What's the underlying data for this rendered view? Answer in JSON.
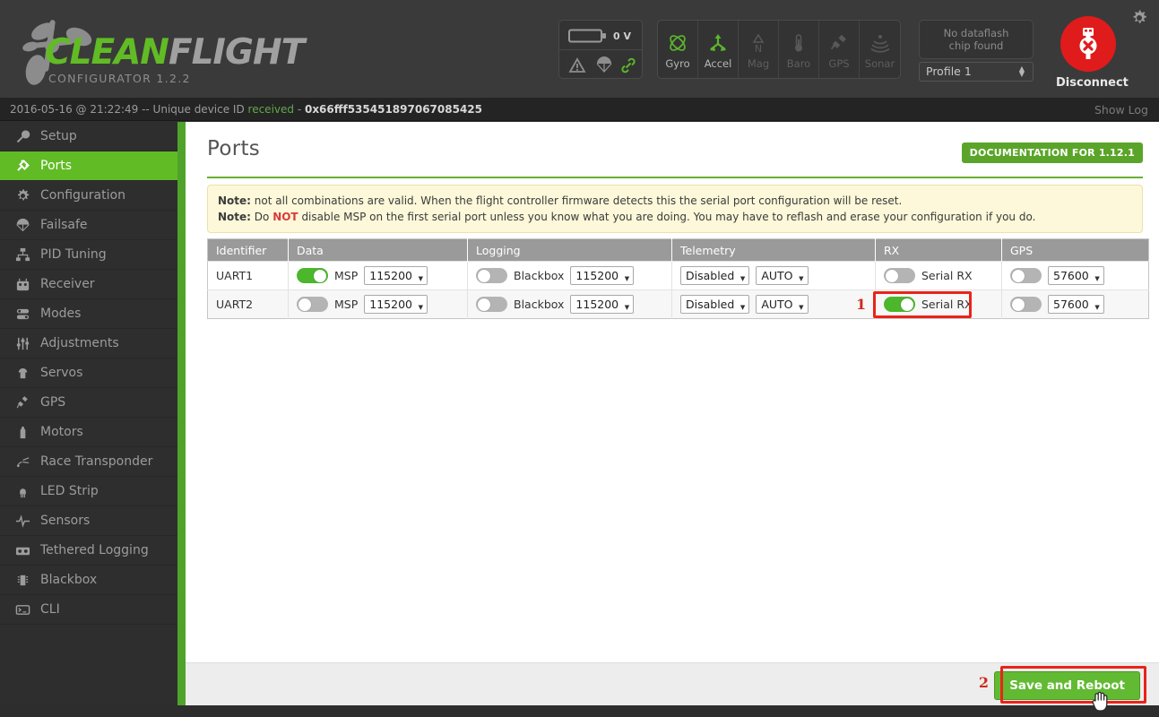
{
  "app": {
    "brand_clean": "CLEAN",
    "brand_flight": "FLIGHT",
    "subtitle": "CONFIGURATOR  1.2.2",
    "accent_green": "#61bb25",
    "danger_red": "#e8241a"
  },
  "header": {
    "battery_voltage": "0 V",
    "status_icons": [
      {
        "name": "warning-icon",
        "active": false
      },
      {
        "name": "parachute-icon",
        "active": false
      },
      {
        "name": "link-icon",
        "active": true
      }
    ],
    "sensors": [
      {
        "label": "Gyro",
        "icon": "gyro-icon",
        "active": true
      },
      {
        "label": "Accel",
        "icon": "accel-icon",
        "active": true
      },
      {
        "label": "Mag",
        "icon": "mag-icon",
        "active": false
      },
      {
        "label": "Baro",
        "icon": "baro-icon",
        "active": false
      },
      {
        "label": "GPS",
        "icon": "gps-icon",
        "active": false
      },
      {
        "label": "Sonar",
        "icon": "sonar-icon",
        "active": false
      }
    ],
    "dataflash_line1": "No dataflash",
    "dataflash_line2": "chip found",
    "profile_value": "Profile 1",
    "disconnect_label": "Disconnect",
    "settings_icon": "gear-icon"
  },
  "logbar": {
    "timestamp_text": "2016-05-16 @ 21:22:49 -- Unique device ID ",
    "status_word": "received",
    "separator": " - ",
    "device_id": "0x66fff535451897067085425",
    "show_log": "Show Log"
  },
  "sidebar": {
    "items": [
      {
        "label": "Setup",
        "icon": "wrench-icon",
        "active": false
      },
      {
        "label": "Ports",
        "icon": "plug-icon",
        "active": true
      },
      {
        "label": "Configuration",
        "icon": "gear-icon",
        "active": false
      },
      {
        "label": "Failsafe",
        "icon": "parachute-icon",
        "active": false
      },
      {
        "label": "PID Tuning",
        "icon": "sitemap-icon",
        "active": false
      },
      {
        "label": "Receiver",
        "icon": "transmitter-icon",
        "active": false
      },
      {
        "label": "Modes",
        "icon": "sliders-icon",
        "active": false
      },
      {
        "label": "Adjustments",
        "icon": "faders-icon",
        "active": false
      },
      {
        "label": "Servos",
        "icon": "servo-icon",
        "active": false
      },
      {
        "label": "GPS",
        "icon": "satellite-icon",
        "active": false
      },
      {
        "label": "Motors",
        "icon": "motor-icon",
        "active": false
      },
      {
        "label": "Race Transponder",
        "icon": "transponder-icon",
        "active": false
      },
      {
        "label": "LED Strip",
        "icon": "led-icon",
        "active": false
      },
      {
        "label": "Sensors",
        "icon": "pulse-icon",
        "active": false
      },
      {
        "label": "Tethered Logging",
        "icon": "cassette-icon",
        "active": false
      },
      {
        "label": "Blackbox",
        "icon": "chip-icon",
        "active": false
      },
      {
        "label": "CLI",
        "icon": "terminal-icon",
        "active": false
      }
    ]
  },
  "page": {
    "title": "Ports",
    "doc_button": "DOCUMENTATION FOR 1.12.1",
    "note1_label": "Note:",
    "note1_text": " not all combinations are valid. When the flight controller firmware detects this the serial port configuration will be reset.",
    "note2_label": "Note:",
    "note2_pre": " Do ",
    "note2_emph": "NOT",
    "note2_post": " disable MSP on the first serial port unless you know what you are doing. You may have to reflash and erase your configuration if you do."
  },
  "table": {
    "columns": [
      "Identifier",
      "Data",
      "Logging",
      "Telemetry",
      "RX",
      "GPS"
    ],
    "rows": [
      {
        "identifier": "UART1",
        "data": {
          "toggle": "on",
          "label": "MSP",
          "baud": "115200"
        },
        "logging": {
          "toggle": "off",
          "label": "Blackbox",
          "baud": "115200"
        },
        "telemetry": {
          "type": "Disabled",
          "baud": "AUTO"
        },
        "rx": {
          "toggle": "off",
          "label": "Serial RX"
        },
        "gps": {
          "toggle": "off",
          "baud": "57600"
        }
      },
      {
        "identifier": "UART2",
        "data": {
          "toggle": "off",
          "label": "MSP",
          "baud": "115200"
        },
        "logging": {
          "toggle": "off",
          "label": "Blackbox",
          "baud": "115200"
        },
        "telemetry": {
          "type": "Disabled",
          "baud": "AUTO"
        },
        "rx": {
          "toggle": "on",
          "label": "Serial RX"
        },
        "gps": {
          "toggle": "off",
          "baud": "57600"
        }
      }
    ]
  },
  "annotations": {
    "marker1": "1",
    "marker2": "2"
  },
  "footer": {
    "save_label": "Save and Reboot"
  }
}
